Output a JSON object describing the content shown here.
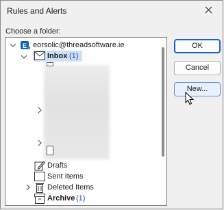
{
  "window": {
    "title": "Rules and Alerts"
  },
  "chooser": {
    "label": "Choose a folder:"
  },
  "tree": {
    "account": "eorsolic@threadsoftware.ie",
    "folders": [
      {
        "name": "Inbox",
        "count": "(1)"
      },
      {
        "name": "Drafts",
        "count": ""
      },
      {
        "name": "Sent Items",
        "count": ""
      },
      {
        "name": "Deleted Items",
        "count": ""
      },
      {
        "name": "Archive",
        "count": "(1)"
      }
    ]
  },
  "buttons": {
    "ok": "OK",
    "cancel": "Cancel",
    "new": "New..."
  },
  "colors": {
    "accent": "#1b62c6",
    "count": "#1f4fb5",
    "selection": "#cde0f7",
    "account_icon": "#0f5fc6"
  }
}
